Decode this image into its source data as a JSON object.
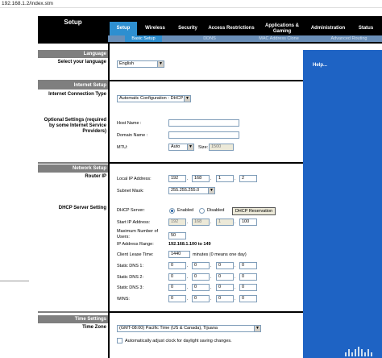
{
  "browser": {
    "url": "192.168.1.2/index.stm"
  },
  "header": {
    "section_title": "Setup",
    "tabs": [
      {
        "label": "Setup"
      },
      {
        "label": "Wireless"
      },
      {
        "label": "Security"
      },
      {
        "label": "Access Restrictions"
      },
      {
        "label": "Applications & Gaming"
      },
      {
        "label": "Administration"
      },
      {
        "label": "Status"
      }
    ],
    "subtabs": [
      {
        "label": "Basic Setup"
      },
      {
        "label": "DDNS"
      },
      {
        "label": "MAC Address Clone"
      },
      {
        "label": "Advanced Routing"
      }
    ]
  },
  "left": {
    "language_head": "Language",
    "language_label": "Select your language",
    "internet_head": "Internet Setup",
    "connection_type_label": "Internet Connection Type",
    "optional_label": "Optional Settings (required by some Internet Service Providers)",
    "network_head": "Network Setup",
    "router_ip_label": "Router IP",
    "dhcp_label": "DHCP Server Setting",
    "time_head": "Time Settings",
    "time_zone_label": "Time Zone"
  },
  "help": {
    "label": "Help..."
  },
  "form": {
    "language_value": "English",
    "connection_type_value": "Automatic Configuration - DHCP",
    "host_name_label": "Host Name :",
    "host_name_value": "",
    "domain_name_label": "Domain Name :",
    "domain_name_value": "",
    "mtu_label": "MTU:",
    "mtu_value": "Auto",
    "size_label": "Size:",
    "size_value": "1500",
    "local_ip_label": "Local IP Address:",
    "local_ip": [
      "192",
      "168",
      "1",
      "2"
    ],
    "subnet_label": "Subnet Mask:",
    "subnet_value": "255.255.255.0",
    "dhcp_server_label": "DHCP Server:",
    "enabled_label": "Enabled",
    "disabled_label": "Disabled",
    "dhcp_reservation_button": "DHCP Reservation",
    "start_ip_label": "Start IP Address:",
    "start_ip": [
      "192",
      "168",
      "1",
      "100"
    ],
    "max_users_label": "Maximum Number of Users:",
    "max_users_value": "50",
    "ip_range_label": "IP Address Range:",
    "ip_range_value": "192.168.1.100  to  149",
    "lease_label": "Client Lease Time:",
    "lease_value": "1440",
    "lease_suffix": "minutes (0 means one day)",
    "dns1_label": "Static DNS 1:",
    "dns2_label": "Static DNS 2:",
    "dns3_label": "Static DNS 3:",
    "wins_label": "WINS:",
    "dns1": [
      "0",
      "0",
      "0",
      "0"
    ],
    "dns2": [
      "0",
      "0",
      "0",
      "0"
    ],
    "dns3": [
      "0",
      "0",
      "0",
      "0"
    ],
    "wins": [
      "0",
      "0",
      "0",
      "0"
    ],
    "timezone_value": "(GMT-08:00) Pacific Time (US & Canada), Tijuana",
    "dst_label": "Automatically adjust clock for daylight saving changes."
  }
}
